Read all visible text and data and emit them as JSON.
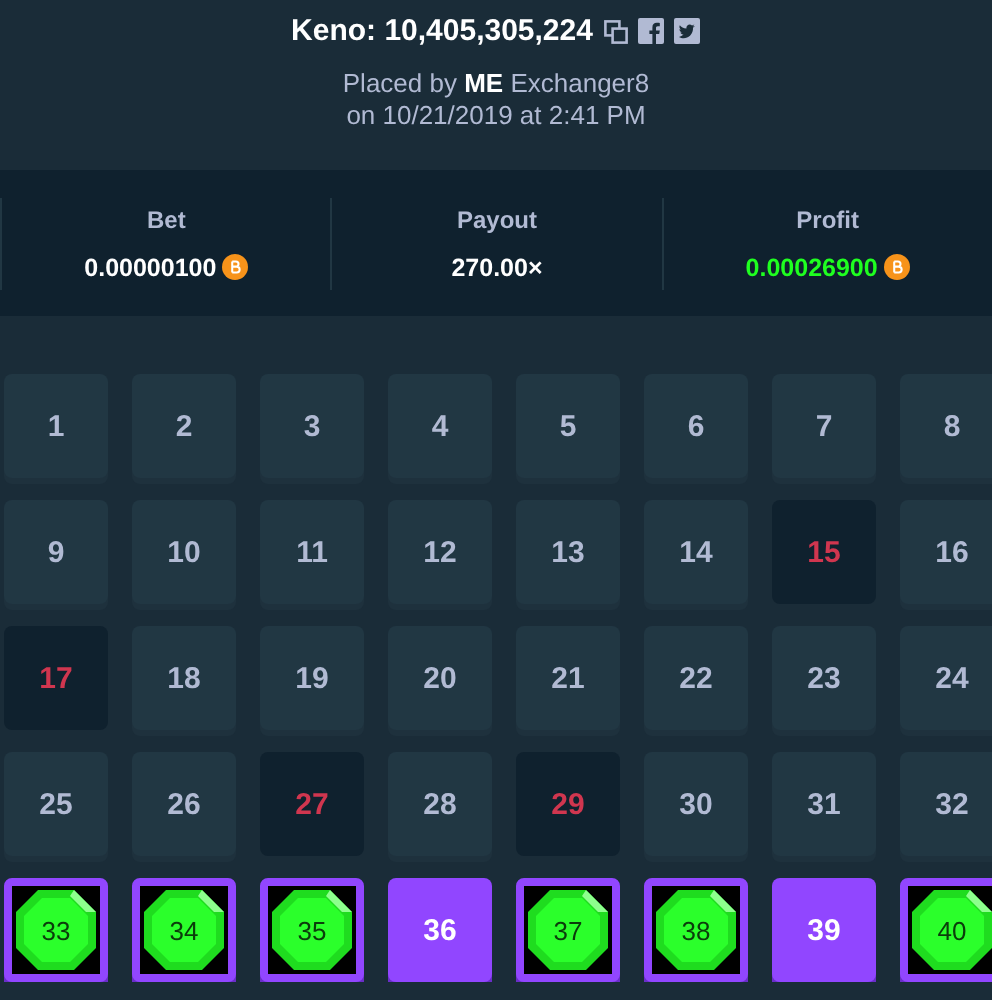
{
  "header": {
    "title": "Keno: 10,405,305,224",
    "placed_by": "Placed by **ME** Exchanger8",
    "date": "on 10/21/2019 at 2:41 PM"
  },
  "stats": [
    {
      "label": "Bet",
      "value": "0.00000100",
      "kind": "amount"
    },
    {
      "label": "Payout",
      "value": "270.00×",
      "kind": "multiplier"
    },
    {
      "label": "Profit",
      "value": "0.00026900",
      "kind": "profit"
    }
  ],
  "tiles": [
    {
      "number": "1",
      "kind": "plain"
    },
    {
      "number": "2",
      "kind": "plain"
    },
    {
      "number": "3",
      "kind": "plain"
    },
    {
      "number": "4",
      "kind": "plain"
    },
    {
      "number": "5",
      "kind": "plain"
    },
    {
      "number": "6",
      "kind": "plain"
    },
    {
      "number": "7",
      "kind": "plain"
    },
    {
      "number": "8",
      "kind": "plain"
    },
    {
      "number": "9",
      "kind": "plain"
    },
    {
      "number": "10",
      "kind": "plain"
    },
    {
      "number": "11",
      "kind": "plain"
    },
    {
      "number": "12",
      "kind": "plain"
    },
    {
      "number": "13",
      "kind": "plain"
    },
    {
      "number": "14",
      "kind": "plain"
    },
    {
      "number": "15",
      "kind": "drawn"
    },
    {
      "number": "16",
      "kind": "plain"
    },
    {
      "number": "17",
      "kind": "drawn"
    },
    {
      "number": "18",
      "kind": "plain"
    },
    {
      "number": "19",
      "kind": "plain"
    },
    {
      "number": "20",
      "kind": "plain"
    },
    {
      "number": "21",
      "kind": "plain"
    },
    {
      "number": "22",
      "kind": "plain"
    },
    {
      "number": "23",
      "kind": "plain"
    },
    {
      "number": "24",
      "kind": "plain"
    },
    {
      "number": "25",
      "kind": "plain"
    },
    {
      "number": "26",
      "kind": "plain"
    },
    {
      "number": "27",
      "kind": "drawn"
    },
    {
      "number": "28",
      "kind": "plain"
    },
    {
      "number": "29",
      "kind": "drawn"
    },
    {
      "number": "30",
      "kind": "plain"
    },
    {
      "number": "31",
      "kind": "plain"
    },
    {
      "number": "32",
      "kind": "plain"
    },
    {
      "number": "33",
      "kind": "hit"
    },
    {
      "number": "34",
      "kind": "hit"
    },
    {
      "number": "35",
      "kind": "hit"
    },
    {
      "number": "36",
      "kind": "picked"
    },
    {
      "number": "37",
      "kind": "hit"
    },
    {
      "number": "38",
      "kind": "hit"
    },
    {
      "number": "39",
      "kind": "picked"
    },
    {
      "number": "40",
      "kind": "hit"
    }
  ]
}
